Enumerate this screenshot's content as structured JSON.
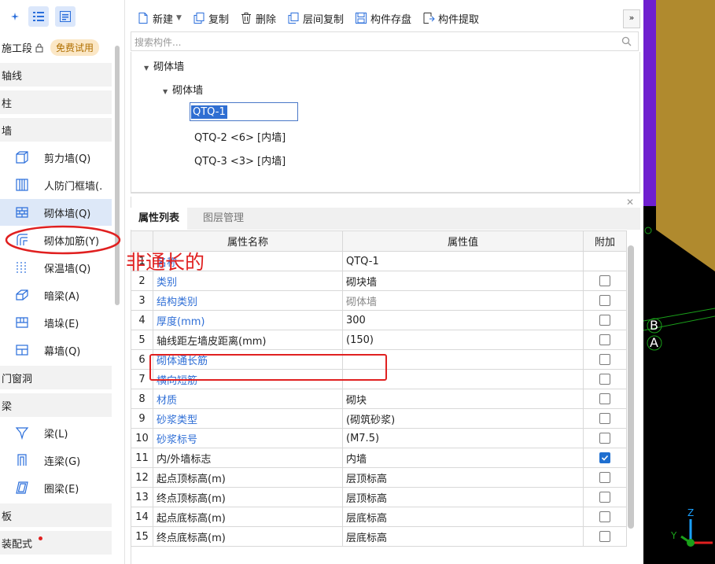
{
  "left_panel": {
    "floor_label": "施工段",
    "trial_badge": "免费试用",
    "categories": {
      "axis": "轴线",
      "column": "柱",
      "wall": "墙",
      "door_window": "门窗洞",
      "beam": "梁",
      "slab": "板",
      "prefab": "装配式"
    },
    "wall_items": [
      "剪力墙(Q)",
      "人防门框墙(.",
      "砌体墙(Q)",
      "砌体加筋(Y)",
      "保温墙(Q)",
      "暗梁(A)",
      "墙垛(E)",
      "幕墙(Q)"
    ],
    "beam_items": [
      "梁(L)",
      "连梁(G)",
      "圈梁(E)"
    ]
  },
  "toolbar": {
    "new": "新建",
    "copy": "复制",
    "delete": "删除",
    "floor_copy": "层间复制",
    "save": "构件存盘",
    "extract": "构件提取",
    "more": "»"
  },
  "search": {
    "placeholder": "搜索构件..."
  },
  "tree": {
    "root": "砌体墙",
    "child": "砌体墙",
    "selected": "QTQ-1",
    "items": [
      "QTQ-2 <6> [内墙]",
      "QTQ-3 <3> [内墙]"
    ]
  },
  "prop_panel": {
    "tab_props": "属性列表",
    "tab_layers": "图层管理",
    "col_name": "属性名称",
    "col_value": "属性值",
    "col_extra": "附加",
    "rows": [
      {
        "n": "1",
        "name": "名称",
        "value": "QTQ-1",
        "checked": null
      },
      {
        "n": "2",
        "name": "类别",
        "value": "砌块墙",
        "checked": false
      },
      {
        "n": "3",
        "name": "结构类别",
        "value": "砌体墙",
        "checked": false
      },
      {
        "n": "4",
        "name": "厚度(mm)",
        "value": "300",
        "checked": false
      },
      {
        "n": "5",
        "name": "轴线距左墙皮距离(mm)",
        "value": "(150)",
        "checked": false
      },
      {
        "n": "6",
        "name": "砌体通长筋",
        "value": "",
        "checked": false
      },
      {
        "n": "7",
        "name": "横向短筋",
        "value": "",
        "checked": false
      },
      {
        "n": "8",
        "name": "材质",
        "value": "砌块",
        "checked": false
      },
      {
        "n": "9",
        "name": "砂浆类型",
        "value": "(砌筑砂浆)",
        "checked": false
      },
      {
        "n": "10",
        "name": "砂浆标号",
        "value": "(M7.5)",
        "checked": false
      },
      {
        "n": "11",
        "name": "内/外墙标志",
        "value": "内墙",
        "checked": true
      },
      {
        "n": "12",
        "name": "起点顶标高(m)",
        "value": "层顶标高",
        "checked": false
      },
      {
        "n": "13",
        "name": "终点顶标高(m)",
        "value": "层顶标高",
        "checked": false
      },
      {
        "n": "14",
        "name": "起点底标高(m)",
        "value": "层底标高",
        "checked": false
      },
      {
        "n": "15",
        "name": "终点底标高(m)",
        "value": "层底标高",
        "checked": false
      }
    ]
  },
  "annotation": {
    "text": "非通长的",
    "color": "#e02020"
  },
  "viewport": {
    "axis_labels": [
      "B",
      "A"
    ],
    "axis_y": "Y",
    "axis_z": "Z"
  },
  "colors": {
    "accent": "#2e6ed6",
    "selected_bg": "#dde8f8",
    "viewport_gold": "#b08a2e",
    "viewport_purple": "#6f1fcf"
  }
}
